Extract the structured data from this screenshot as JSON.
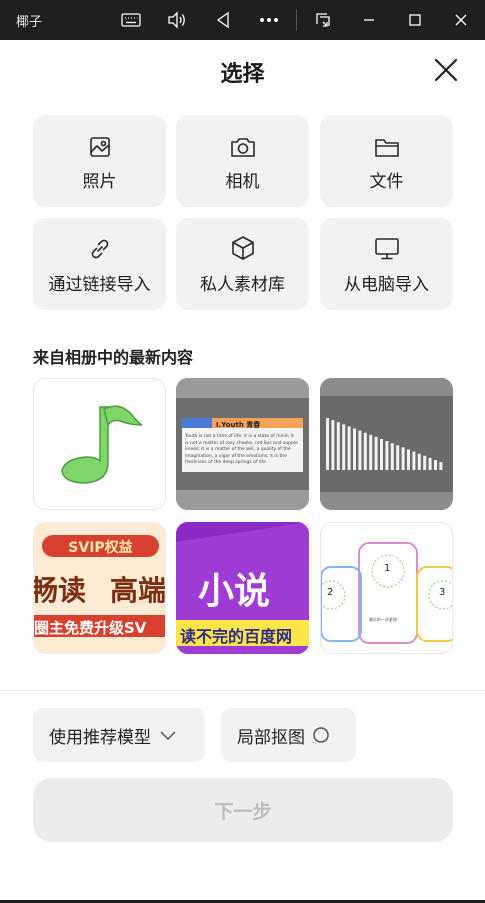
{
  "system_bar": {
    "app_name": "椰子",
    "icons": [
      "keyboard-icon",
      "volume-icon",
      "back-icon",
      "more-icon",
      "screenshot-icon",
      "minimize-icon",
      "maximize-icon",
      "close-icon"
    ]
  },
  "header": {
    "title": "选择",
    "close_icon": "close-icon"
  },
  "sources": [
    {
      "label": "照片",
      "icon": "image-icon"
    },
    {
      "label": "相机",
      "icon": "camera-icon"
    },
    {
      "label": "文件",
      "icon": "folder-icon"
    },
    {
      "label": "通过链接导入",
      "icon": "link-icon"
    },
    {
      "label": "私人素材库",
      "icon": "cube-icon"
    },
    {
      "label": "从电脑导入",
      "icon": "monitor-icon"
    }
  ],
  "recent": {
    "title": "来自相册中的最新内容",
    "thumbnails": [
      {
        "kind": "music-note-image"
      },
      {
        "kind": "document-image",
        "heading": "I.Youth 青春",
        "lines": [
          "Youth is not a time of life; it is a state of mind; it",
          "is not a matter of rosy cheeks, red lips and supple",
          "knees; it is a matter of the will, a quality of the",
          "imagination, a vigor of the emotions; it is the",
          "freshness of the deep springs of life."
        ]
      },
      {
        "kind": "bars-image"
      },
      {
        "kind": "banner-image",
        "badge": "SVIP权益",
        "big_left": "畅读",
        "big_right": "高端",
        "bottom": "圈主免费升级SV"
      },
      {
        "kind": "novel-banner-image",
        "big": "小说",
        "bottom": "读不完的百度网"
      },
      {
        "kind": "diagram-image",
        "nums": [
          "1",
          "2",
          "3"
        ],
        "caption": "最近的一次更改"
      }
    ]
  },
  "options": {
    "model_label": "使用推荐模型",
    "cutout_label": "局部抠图"
  },
  "next_button": {
    "label": "下一步"
  },
  "colors": {
    "accent_green": "#6fcf5f",
    "tile_bg": "#f2f2f2",
    "button_disabled_text": "#bdbdbd"
  }
}
